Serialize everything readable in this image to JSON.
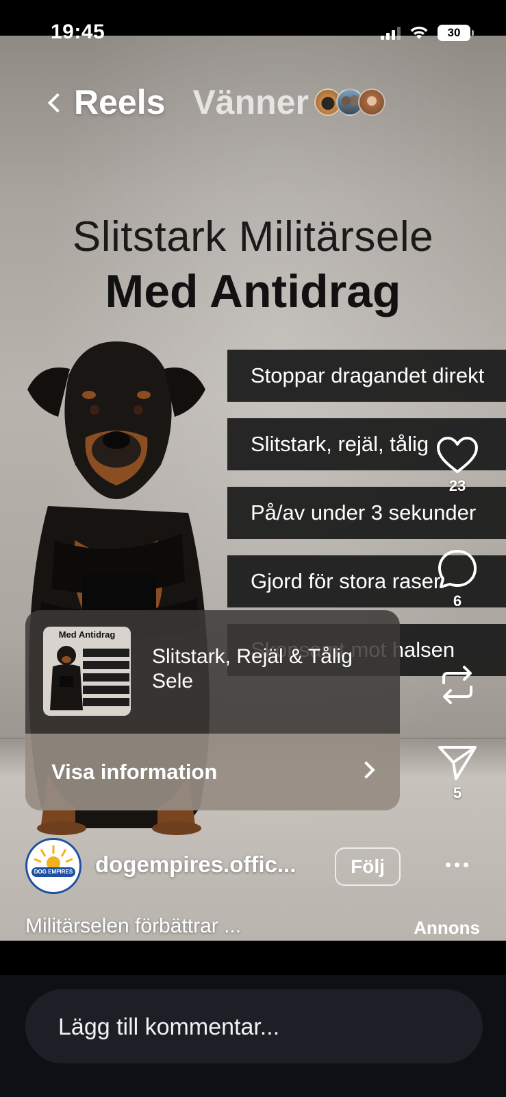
{
  "status_bar": {
    "time": "19:45",
    "battery": "30"
  },
  "nav": {
    "reels_label": "Reels",
    "friends_label": "Vänner",
    "friend_avatar_icons": [
      "cat-avatar",
      "couple-avatar",
      "woman-avatar"
    ]
  },
  "ad": {
    "headline_line1": "Slitstark Militärsele",
    "headline_line2": "Med Antidrag",
    "bullets": [
      "Stoppar dragandet direkt",
      "Slitstark, rejäl, tålig",
      "På/av under 3 sekunder",
      "Gjord för stora raser",
      "Skonsamt mot halsen"
    ]
  },
  "actions": {
    "like_count": "23",
    "comment_count": "6",
    "share_count": "5",
    "icons": [
      "heart-icon",
      "comment-icon",
      "repost-icon",
      "send-icon"
    ]
  },
  "product_card": {
    "thumb_title": "Med Antidrag",
    "name": "Slitstark, Rejäl & Tålig Sele",
    "cta_label": "Visa information"
  },
  "account": {
    "username": "dogempires.offic...",
    "follow_label": "Följ",
    "logo_text": "DOG EMPIRES"
  },
  "caption": "Militärselen förbättrar ...",
  "ad_label": "Annons",
  "comment": {
    "placeholder": "Lägg till kommentar..."
  },
  "colors": {
    "background_panel": "#0d1116",
    "comment_input": "#1c2026",
    "bullet_bg": "#191919",
    "logo_blue": "#1e4fa2"
  }
}
